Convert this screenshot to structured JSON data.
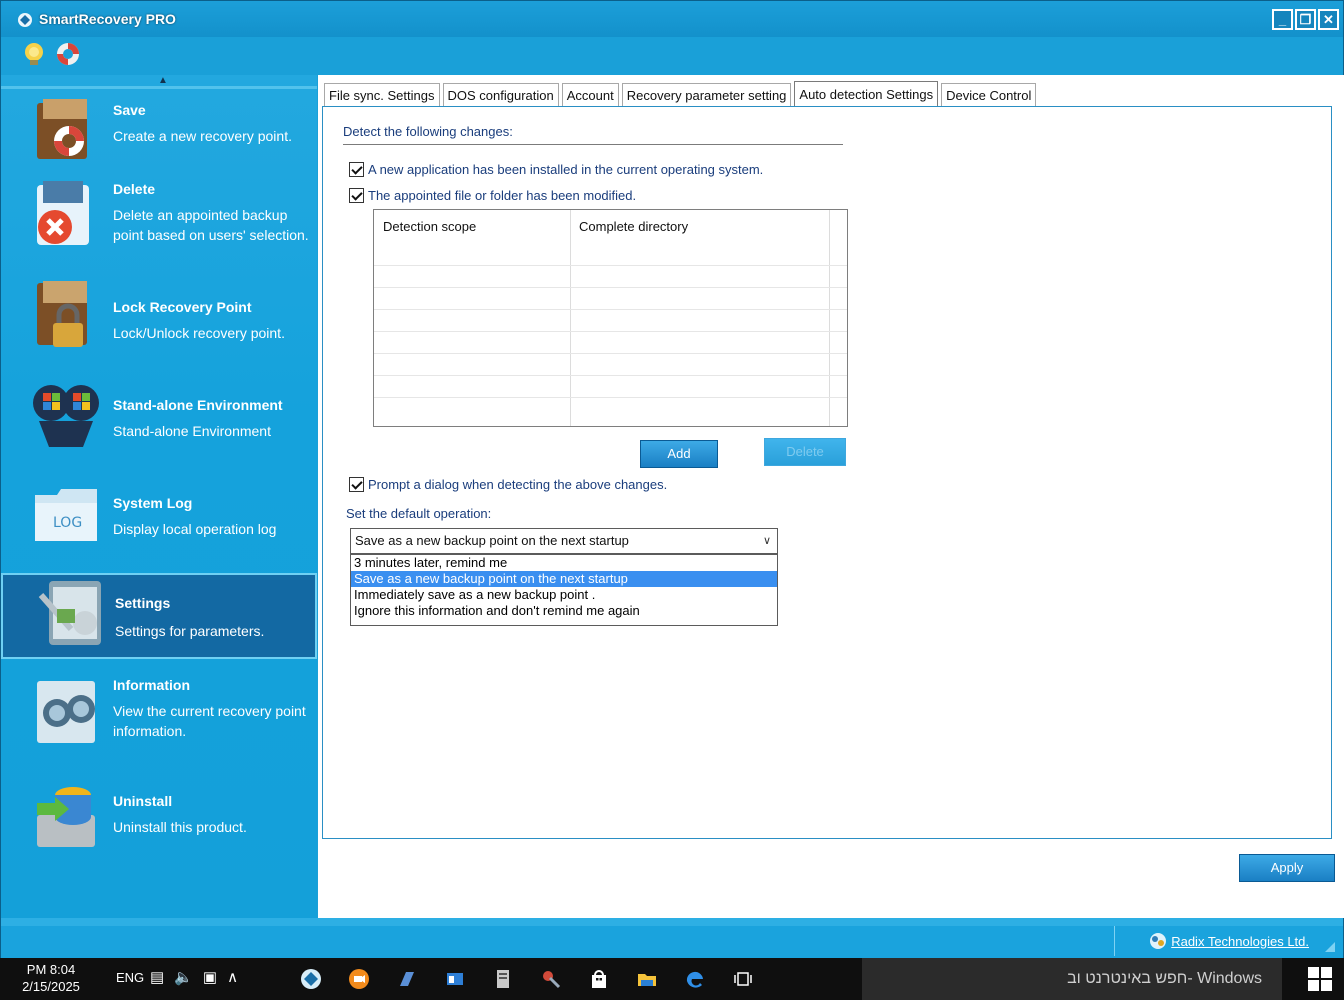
{
  "window": {
    "title": "SmartRecovery PRO",
    "controls": [
      "_",
      "❐",
      "✕"
    ],
    "icons": [
      "help-bulb-icon",
      "lifebuoy-icon"
    ]
  },
  "sidebar": {
    "items": [
      {
        "title": "Save",
        "desc": "Create a new recovery point.",
        "icon": "save-recovery-icon"
      },
      {
        "title": "Delete",
        "desc": "Delete an appointed backup point based on users' selection.",
        "icon": "delete-icon"
      },
      {
        "title": "Lock Recovery Point",
        "desc": "Lock/Unlock recovery point.",
        "icon": "lock-icon"
      },
      {
        "title": "Stand-alone Environment",
        "desc": "Stand-alone Environment",
        "icon": "standalone-icon"
      },
      {
        "title": "System Log",
        "desc": "Display local operation log",
        "icon": "log-folder-icon",
        "icon_text": "LOG"
      },
      {
        "title": "Settings",
        "desc": "Settings for parameters.",
        "icon": "settings-icon"
      },
      {
        "title": "Information",
        "desc": "View the current recovery point information.",
        "icon": "binoculars-icon"
      },
      {
        "title": "Uninstall",
        "desc": "Uninstall this product.",
        "icon": "uninstall-icon"
      }
    ],
    "active_index": 5
  },
  "tabs": [
    {
      "label": "File sync. Settings"
    },
    {
      "label": "DOS configuration"
    },
    {
      "label": "Account"
    },
    {
      "label": "Recovery parameter setting"
    },
    {
      "label": "Auto detection Settings",
      "active": true
    },
    {
      "label": "Device Control"
    }
  ],
  "panel": {
    "heading": "Detect the following changes:",
    "check_new_app": "A new application has been installed in the current operating system.",
    "check_file_modified": "The appointed file or folder has been modified.",
    "table": {
      "columns": [
        "Detection scope",
        "Complete directory"
      ],
      "rows": []
    },
    "add_button": "Add",
    "delete_button": "Delete",
    "check_prompt": "Prompt a dialog when detecting the above changes.",
    "default_op_label": "Set the default operation:",
    "default_op_value": "Save as a new backup point on the next startup",
    "default_op_options": [
      "3 minutes later, remind me",
      "Save as a new backup point on the next startup",
      "Immediately save as a new backup point .",
      "Ignore this information and don't remind me again"
    ],
    "selected_option_index": 1
  },
  "apply_button": "Apply",
  "statusbar": {
    "vendor": "Radix Technologies Ltd."
  },
  "taskbar": {
    "time": "PM 8:04",
    "date": "2/15/2025",
    "lang": "ENG",
    "search_placeholder": "חפש באינטרנט וב- Windows"
  },
  "colors": {
    "accent": "#1aa0d8",
    "active_nav": "#1369a3",
    "label_text": "#1a3d7c",
    "selection": "#3a8ff0"
  }
}
